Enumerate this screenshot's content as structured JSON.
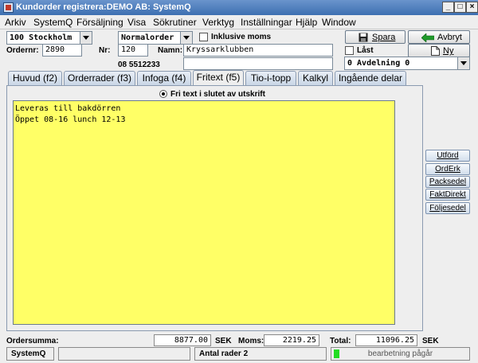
{
  "window": {
    "title": "Kundorder registrera:DEMO AB: SystemQ"
  },
  "menu": [
    "Arkiv",
    "SystemQ",
    "Försäljning",
    "Visa",
    "Sökrutiner",
    "Verktyg",
    "Inställningar",
    "Hjälp",
    "Window"
  ],
  "header": {
    "location_select": "100 Stockholm",
    "order_type_select": "Normalorder",
    "inclusive_vat_label": "Inklusive moms",
    "ordernr_label": "Ordernr:",
    "ordernr_value": "2890",
    "nr_label": "Nr:",
    "nr_value": "120",
    "name_label": "Namn:",
    "name_value": "Kryssarklubben",
    "phone": "08 5512233",
    "extra_value": "",
    "locked_label": "Låst",
    "department_select": "0 Avdelning 0",
    "save_label": "Spara",
    "cancel_label": "Avbryt",
    "new_label": "Ny"
  },
  "tabs": [
    "Huvud (f2)",
    "Orderrader (f3)",
    "Infoga (f4)",
    "Fritext (f5)",
    "Tio-i-topp",
    "Kalkyl",
    "Ingående delar"
  ],
  "active_tab": "Fritext (f5)",
  "fritext": {
    "radio_label": "Fri text i slutet av utskrift",
    "lines": [
      "Leveras till bakdörren",
      "Öppet 08-16 lunch 12-13"
    ]
  },
  "side_buttons": [
    "Utförd",
    "OrdErk",
    "Packsedel",
    "FaktDirekt",
    "Följesedel"
  ],
  "totals": {
    "ordersumma_label": "Ordersumma:",
    "ordersumma_value": "8877.00",
    "currency": "SEK",
    "moms_label": "Moms:",
    "moms_value": "2219.25",
    "total_label": "Total:",
    "total_value": "11096.25"
  },
  "statusbar": {
    "app_name": "SystemQ",
    "empty_box": "",
    "rows_text": "Antal rader 2",
    "progress_text": "bearbetning pågår",
    "progress_fraction": 0.04
  },
  "colors": {
    "title_bar": "#3d6fb1",
    "textarea_bg": "#ffff66",
    "progress_fill": "#22dd22"
  }
}
